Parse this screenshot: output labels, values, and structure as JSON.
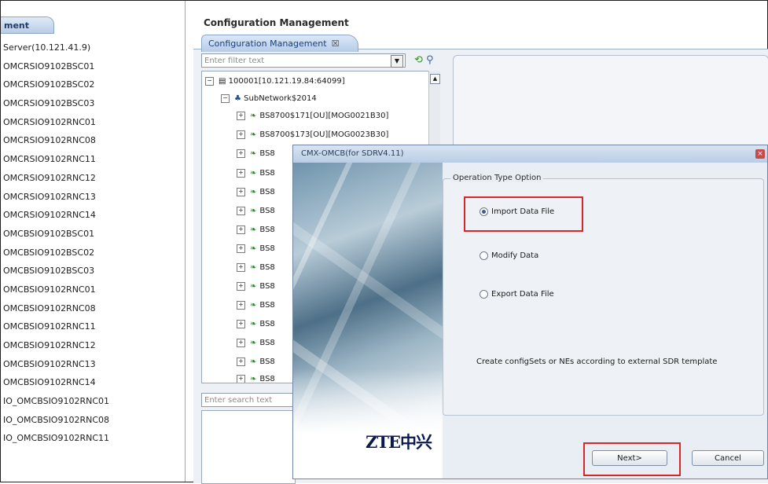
{
  "left_panel": {
    "tab_label": "ment",
    "items": [
      "Server(10.121.41.9)",
      "OMCRSIO9102BSC01",
      "OMCRSIO9102BSC02",
      "OMCRSIO9102BSC03",
      "OMCRSIO9102RNC01",
      "OMCRSIO9102RNC08",
      "OMCRSIO9102RNC11",
      "OMCRSIO9102RNC12",
      "OMCRSIO9102RNC13",
      "OMCRSIO9102RNC14",
      "OMCBSIO9102BSC01",
      "OMCBSIO9102BSC02",
      "OMCBSIO9102BSC03",
      "OMCBSIO9102RNC01",
      "OMCBSIO9102RNC08",
      "OMCBSIO9102RNC11",
      "OMCBSIO9102RNC12",
      "OMCBSIO9102RNC13",
      "OMCBSIO9102RNC14",
      "IO_OMCBSIO9102RNC01",
      "IO_OMCBSIO9102RNC08",
      "IO_OMCBSIO9102RNC11"
    ]
  },
  "main": {
    "title": "Configuration Management",
    "tab_label": "Configuration Management",
    "tab_close": "☒",
    "filter_placeholder": "Enter filter text",
    "search_placeholder": "Enter search text"
  },
  "tree": {
    "root": "100001[10.121.19.84:64099]",
    "subnetwork": "SubNetwork$2014",
    "nodes": [
      "BS8700$171[OU][MOG0021B30]",
      "BS8700$173[OU][MOG0023B30]",
      "BS8",
      "BS8",
      "BS8",
      "BS8",
      "BS8",
      "BS8",
      "BS8",
      "BS8",
      "BS8",
      "BS8",
      "BS8",
      "BS8",
      "BS8"
    ]
  },
  "dialog": {
    "title": "CMX-OMCB(for SDRV4.11)",
    "group_label": "Operation Type Option",
    "options": [
      {
        "label": "Import Data File",
        "selected": true
      },
      {
        "label": "Modify Data",
        "selected": false
      },
      {
        "label": "Export Data File",
        "selected": false
      }
    ],
    "description": "Create configSets or NEs according to external SDR template",
    "next_label": "Next>",
    "cancel_label": "Cancel",
    "logo_text": "ZTE中兴"
  },
  "colors": {
    "highlight": "#d62828",
    "tab_gradient_top": "#dae8f8",
    "leaf_icon": "#1f8a1f"
  }
}
